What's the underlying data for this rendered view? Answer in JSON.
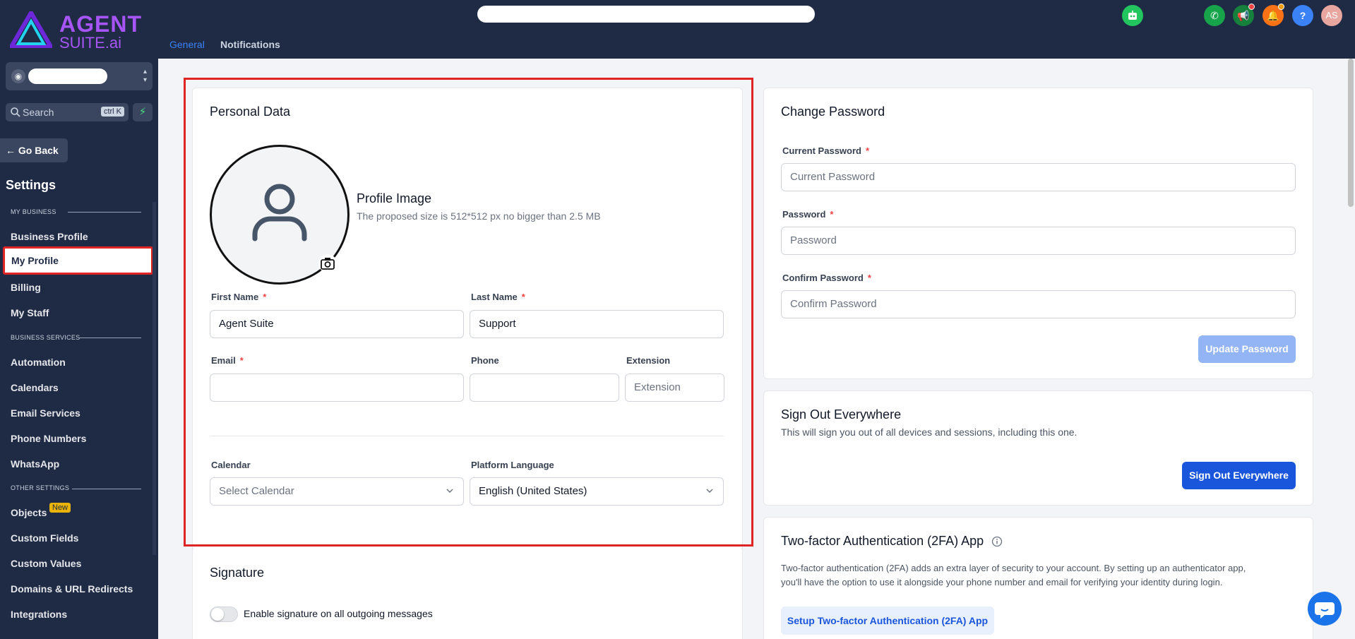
{
  "brand": {
    "line1": "AGENT",
    "line2": "SUITE.ai"
  },
  "sidebar": {
    "search_placeholder": "Search",
    "search_shortcut": "ctrl K",
    "go_back": "Go Back",
    "title": "Settings",
    "sections": [
      {
        "label": "MY BUSINESS",
        "items": [
          "Business Profile",
          "My Profile",
          "Billing",
          "My Staff"
        ]
      },
      {
        "label": "BUSINESS SERVICES",
        "items": [
          "Automation",
          "Calendars",
          "Email Services",
          "Phone Numbers",
          "WhatsApp"
        ]
      },
      {
        "label": "OTHER SETTINGS",
        "items": [
          "Objects",
          "Custom Fields",
          "Custom Values",
          "Domains & URL Redirects",
          "Integrations"
        ]
      }
    ],
    "active_item": "My Profile",
    "badge_new": "New"
  },
  "header": {
    "tabs": [
      {
        "label": "General",
        "active": true
      },
      {
        "label": "Notifications",
        "active": false
      }
    ],
    "user_initials": "AS",
    "help": "?"
  },
  "personal_data": {
    "title": "Personal Data",
    "profile_image_title": "Profile Image",
    "profile_image_hint": "The proposed size is 512*512 px no bigger than 2.5 MB",
    "first_name_label": "First Name",
    "first_name_value": "Agent Suite",
    "last_name_label": "Last Name",
    "last_name_value": "Support",
    "email_label": "Email",
    "email_value": "",
    "phone_label": "Phone",
    "phone_value": "",
    "extension_label": "Extension",
    "extension_placeholder": "Extension",
    "calendar_label": "Calendar",
    "calendar_placeholder": "Select Calendar",
    "language_label": "Platform Language",
    "language_value": "English (United States)",
    "required_mark": "*"
  },
  "signature": {
    "title": "Signature",
    "toggle_label": "Enable signature on all outgoing messages",
    "enabled": false
  },
  "change_password": {
    "title": "Change Password",
    "current_label": "Current Password",
    "current_placeholder": "Current Password",
    "password_label": "Password",
    "password_placeholder": "Password",
    "confirm_label": "Confirm Password",
    "confirm_placeholder": "Confirm Password",
    "update_button": "Update Password"
  },
  "sign_out": {
    "title": "Sign Out Everywhere",
    "description": "This will sign you out of all devices and sessions, including this one.",
    "button": "Sign Out Everywhere"
  },
  "two_factor": {
    "title": "Two-factor Authentication (2FA) App",
    "description_line1": "Two-factor authentication (2FA) adds an extra layer of security to your account. By setting up an authenticator app,",
    "description_line2": "you'll have the option to use it alongside your phone number and email for verifying your identity during login.",
    "button": "Setup Two-factor Authentication (2FA) App"
  },
  "colors": {
    "sidebar_bg": "#1f2a44",
    "accent_blue": "#1a56db",
    "highlight_red": "#e02424",
    "brand_purple": "#a855f7"
  }
}
